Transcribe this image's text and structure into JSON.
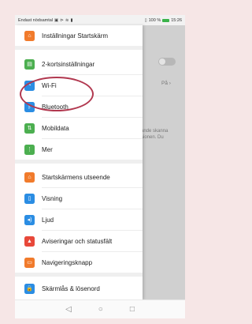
{
  "statusbar": {
    "left_text": "Endast nödsamtal",
    "battery_text": "100 %",
    "time": "15:26"
  },
  "background_page": {
    "pa_label": "På ›",
    "text_line1": "ande skanna",
    "text_line2": "sionen. Du"
  },
  "drawer": {
    "items": [
      {
        "label": "Inställningar Startskärm",
        "icon": "home-icon",
        "color": "#f17b2c"
      },
      {
        "label": "2-kortsinställningar",
        "icon": "sim-card-icon",
        "color": "#4caf50"
      },
      {
        "label": "Wi-Fi",
        "icon": "wifi-icon",
        "color": "#2b8de3"
      },
      {
        "label": "Bluetooth",
        "icon": "bluetooth-icon",
        "color": "#2b8de3"
      },
      {
        "label": "Mobildata",
        "icon": "mobile-data-icon",
        "color": "#4caf50"
      },
      {
        "label": "Mer",
        "icon": "more-icon",
        "color": "#4caf50"
      },
      {
        "label": "Startskärmens utseende",
        "icon": "home-screen-style-icon",
        "color": "#f17b2c"
      },
      {
        "label": "Visning",
        "icon": "display-icon",
        "color": "#2b8de3"
      },
      {
        "label": "Ljud",
        "icon": "sound-icon",
        "color": "#2b8de3"
      },
      {
        "label": "Aviseringar och statusfält",
        "icon": "notifications-icon",
        "color": "#e8483a"
      },
      {
        "label": "Navigeringsknapp",
        "icon": "navigation-button-icon",
        "color": "#f17b2c"
      },
      {
        "label": "Skärmlås & lösenord",
        "icon": "lock-icon",
        "color": "#2b8de3"
      }
    ]
  },
  "navbar": {
    "back": "◁",
    "home": "○",
    "recents": "□"
  },
  "highlight_color": "#b1384f"
}
